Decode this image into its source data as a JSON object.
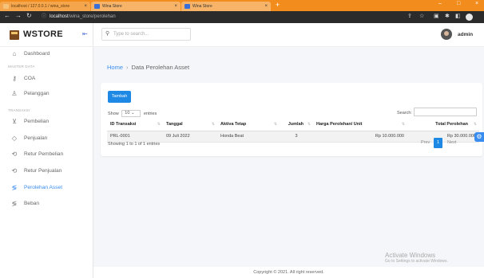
{
  "browser": {
    "tabs": [
      {
        "title": "localhost / 127.0.0.1 / wina_store"
      },
      {
        "title": "Wina Store"
      },
      {
        "title": "Wina Store"
      }
    ],
    "new_tab": "+",
    "url_host": "localhost",
    "url_path": "/wina_store/perolehan",
    "win_controls": {
      "minimize": "–",
      "maximize": "□",
      "close": "×"
    }
  },
  "sidebar": {
    "brand": "WSTORE",
    "collapse": "⇤",
    "dashboard": "Dashboard",
    "master_header": "MASTER DATA",
    "master_items": [
      {
        "label": "COA",
        "icon": "key-icon"
      },
      {
        "label": "Pelanggan",
        "icon": "users-icon"
      }
    ],
    "trans_header": "TRANSAKSI",
    "trans_items": [
      {
        "label": "Pembelian",
        "icon": "cart-icon"
      },
      {
        "label": "Penjualan",
        "icon": "tag-icon"
      },
      {
        "label": "Retur Pembelian",
        "icon": "return-icon"
      },
      {
        "label": "Retur Penjualan",
        "icon": "return-icon"
      },
      {
        "label": "Perolehan Asset",
        "icon": "asset-icon"
      },
      {
        "label": "Beban",
        "icon": "expense-icon"
      }
    ]
  },
  "topbar": {
    "search_placeholder": "Type to search...",
    "user": "admin"
  },
  "breadcrumb": {
    "home": "Home",
    "separator": "›",
    "current": "Data Perolehan Asset"
  },
  "card": {
    "add_button": "Tambah",
    "show_label": "Show",
    "show_value": "10",
    "show_caret": "⌄",
    "entries_label": "entries",
    "search_label": "Search:",
    "columns": [
      "ID Transaksi",
      "Tanggal",
      "Aktiva Tetap",
      "Jumlah",
      "Harga Perolehan/ Unit",
      "Total Perolehan"
    ],
    "rows": [
      [
        "PRL-0001",
        "09 Juli 2022",
        "Honda Beat",
        "3",
        "Rp 10.000.000",
        "Rp 30.000.000"
      ]
    ],
    "info": "Showing 1 to 1 of 1 entries",
    "pager": {
      "prev": "Prev",
      "page": "1",
      "next": "Next"
    }
  },
  "footer": "Copyright © 2021. All right reserved.",
  "watermark": {
    "title": "Activate Windows",
    "subtitle": "Go to Settings to activate Windows."
  },
  "colors": {
    "tabbar": "#f28c1d",
    "primary": "#1e88e5",
    "active": "#3a8df0"
  }
}
